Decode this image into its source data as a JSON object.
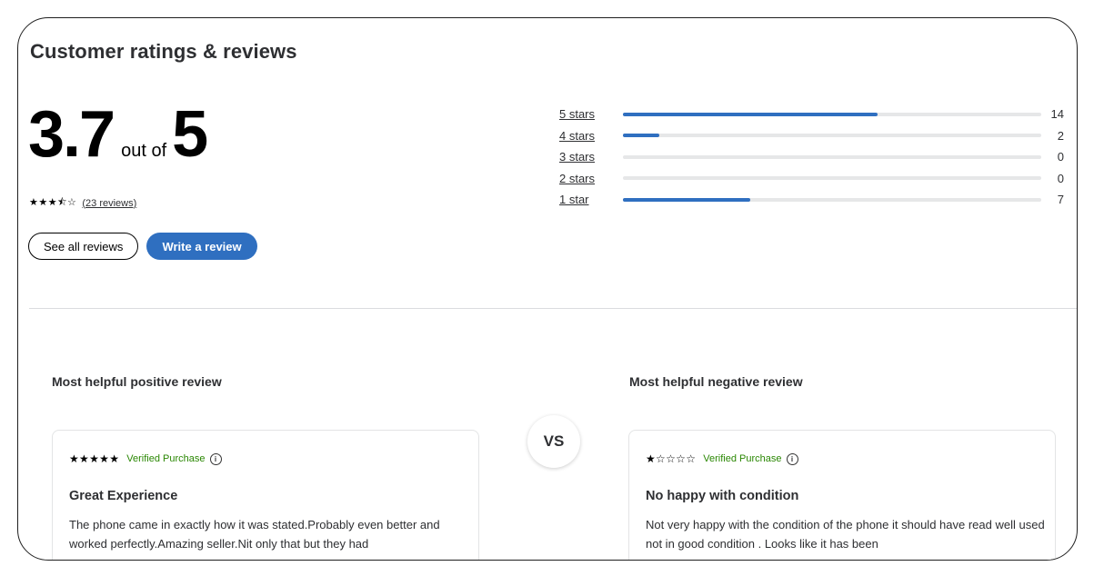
{
  "header": {
    "title": "Customer ratings & reviews"
  },
  "summary": {
    "average": "3.7",
    "out_of": "out of",
    "max": "5",
    "stars": "★★★⯪☆",
    "review_count_link": "(23 reviews)"
  },
  "actions": {
    "see_all": "See all reviews",
    "write": "Write a review"
  },
  "distribution": {
    "max_count": 23,
    "rows": [
      {
        "label": "5 stars",
        "count": "14",
        "fraction": 0.609
      },
      {
        "label": "4 stars",
        "count": "2",
        "fraction": 0.087
      },
      {
        "label": "3 stars",
        "count": "0",
        "fraction": 0
      },
      {
        "label": "2 stars",
        "count": "0",
        "fraction": 0
      },
      {
        "label": "1 star",
        "count": "7",
        "fraction": 0.304
      }
    ]
  },
  "positive": {
    "heading": "Most helpful positive review",
    "stars": "★★★★★",
    "verified": "Verified Purchase",
    "title": "Great Experience",
    "body": "The phone came in exactly how it was stated.Probably even better and worked perfectly.Amazing seller.Nit only that but they had"
  },
  "negative": {
    "heading": "Most helpful negative review",
    "stars": "★☆☆☆☆",
    "verified": "Verified Purchase",
    "title": "No happy with condition",
    "body": "Not very happy with the condition of the phone it should have read well used not in good condition . Looks like it has been"
  },
  "vs": "VS",
  "info_glyph": "i",
  "colors": {
    "accent": "#2f6fc0",
    "verified": "#2a8703",
    "track": "#e6e7e8"
  }
}
